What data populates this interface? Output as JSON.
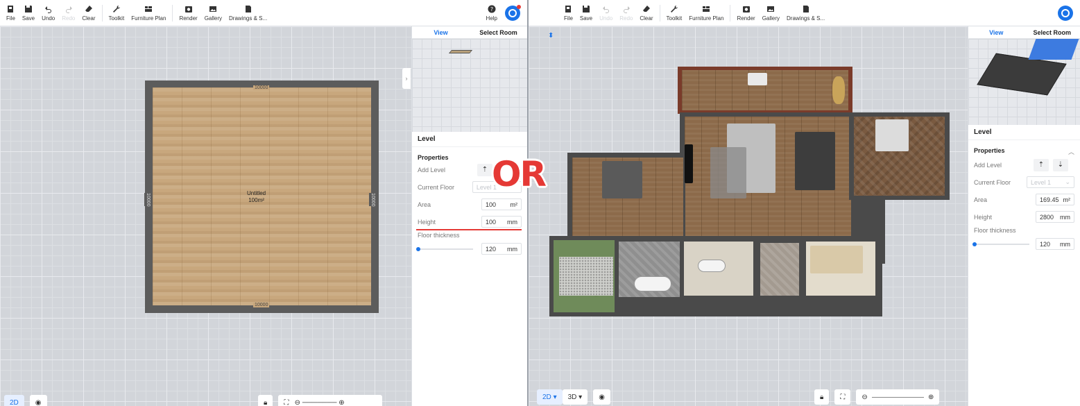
{
  "toolbar": {
    "file": "File",
    "save": "Save",
    "undo": "Undo",
    "redo": "Redo",
    "clear": "Clear",
    "toolkit": "Toolkit",
    "furniture_plan": "Furniture Plan",
    "render": "Render",
    "gallery": "Gallery",
    "drawings": "Drawings & S...",
    "help": "Help"
  },
  "left": {
    "tabs": {
      "view": "View",
      "select_room": "Select Room"
    },
    "panel_title": "Level",
    "properties_label": "Properties",
    "add_level_label": "Add Level",
    "current_floor_label": "Current Floor",
    "current_floor_value": "Level 1",
    "area_label": "Area",
    "area_value": "100",
    "area_unit": "m²",
    "height_label": "Height",
    "height_value": "100",
    "height_unit": "mm",
    "floor_thickness_label": "Floor thickness",
    "floor_thickness_value": "120",
    "floor_thickness_unit": "mm",
    "room": {
      "name": "Untitled",
      "area": "100m²",
      "dim_top": "10000",
      "dim_bottom": "10000",
      "dim_left": "10000",
      "dim_right": "10000"
    },
    "bottom": {
      "mode_2d": "2D"
    }
  },
  "right": {
    "tabs": {
      "view": "View",
      "select_room": "Select Room"
    },
    "panel_title": "Level",
    "properties_label": "Properties",
    "add_level_label": "Add Level",
    "current_floor_label": "Current Floor",
    "current_floor_value": "Level 1",
    "area_label": "Area",
    "area_value": "169.45",
    "area_unit": "m²",
    "height_label": "Height",
    "height_value": "2800",
    "height_unit": "mm",
    "floor_thickness_label": "Floor thickness",
    "floor_thickness_value": "120",
    "floor_thickness_unit": "mm",
    "bottom": {
      "mode_2d": "2D",
      "mode_3d": "3D"
    }
  },
  "overlay": {
    "or_text": "OR"
  },
  "colors": {
    "accent": "#1a73e8",
    "highlight": "#e53935"
  }
}
